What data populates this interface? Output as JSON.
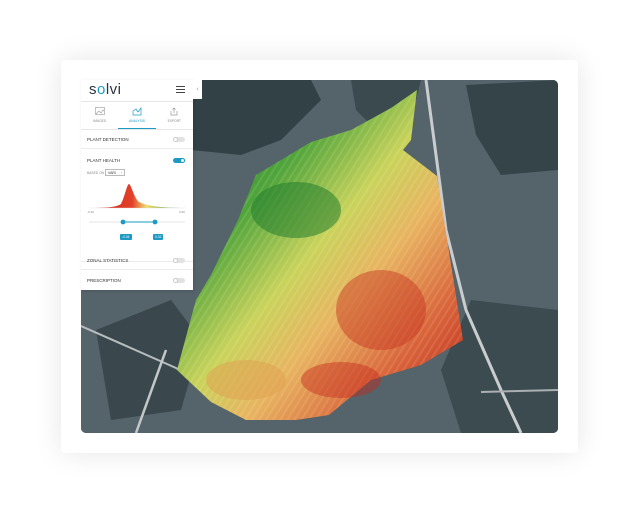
{
  "app": {
    "logo": "solvi"
  },
  "tabs": [
    {
      "label": "IMAGES",
      "icon": "images-icon",
      "active": false
    },
    {
      "label": "ANALYSIS",
      "icon": "analysis-icon",
      "active": true
    },
    {
      "label": "EXPORT",
      "icon": "export-icon",
      "active": false
    }
  ],
  "collapse_glyph": "‹",
  "layers": {
    "plant_detection": {
      "label": "PLANT DETECTION",
      "enabled": false
    },
    "plant_health": {
      "label": "PLANT HEALTH",
      "enabled": true
    },
    "zonal_statistics": {
      "label": "ZONAL STATISTICS",
      "enabled": false
    },
    "prescription": {
      "label": "PRESCRIPTION",
      "enabled": false
    }
  },
  "health": {
    "based_on_label": "BASED ON",
    "index": "VARI",
    "axis_min": "-0.30",
    "axis_max": "0.60",
    "range_low": "-0.04",
    "range_high": "0.32"
  },
  "colors": {
    "accent": "#1d9ac4",
    "health_low": "#c8241a",
    "health_mid": "#f0e070",
    "health_high": "#1e7a2c"
  }
}
